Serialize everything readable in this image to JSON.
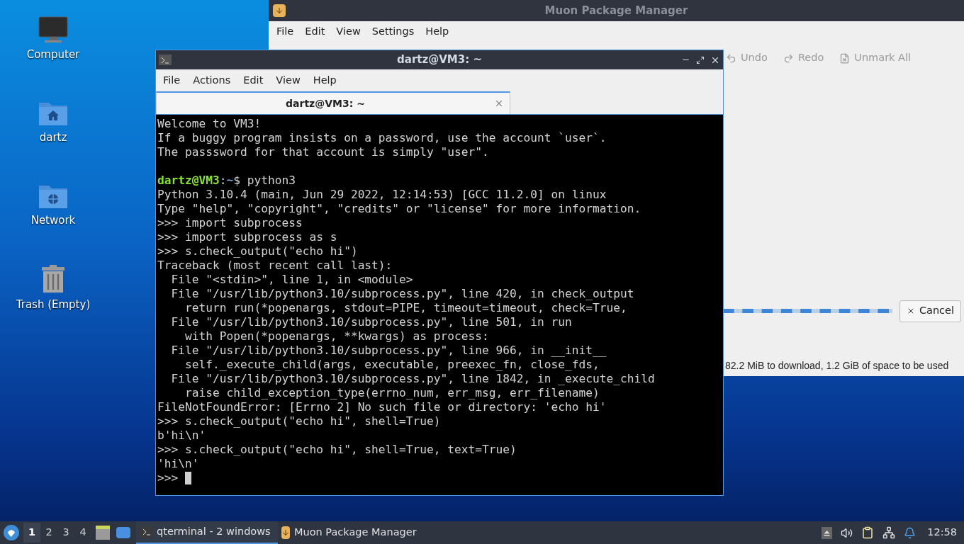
{
  "desktop_icons": [
    {
      "kind": "computer",
      "label": "Computer"
    },
    {
      "kind": "home",
      "label": "dartz"
    },
    {
      "kind": "network",
      "label": "Network"
    },
    {
      "kind": "trash",
      "label": "Trash (Empty)"
    }
  ],
  "muon": {
    "title": "Muon Package Manager",
    "menu": [
      "File",
      "Edit",
      "View",
      "Settings",
      "Help"
    ],
    "toolbar": [
      {
        "kind": "undo",
        "label": "Undo"
      },
      {
        "kind": "redo",
        "label": "Redo"
      },
      {
        "kind": "unmark",
        "label": "Unmark All"
      }
    ],
    "busy": true,
    "cancel_button": "Cancel",
    "status": "82.2 MiB to download, 1.2 GiB of space to be used"
  },
  "terminal": {
    "title": "dartz@VM3: ~",
    "menu": [
      "File",
      "Actions",
      "Edit",
      "View",
      "Help"
    ],
    "tabs": [
      {
        "label": "dartz@VM3: ~",
        "selected": true
      }
    ],
    "lines": [
      {
        "kind": "text",
        "text": "Welcome to VM3!"
      },
      {
        "kind": "text",
        "text": "If a buggy program insists on a password, use the account `user`."
      },
      {
        "kind": "text",
        "text": "The passsword for that account is simply \"user\"."
      },
      {
        "kind": "blank"
      },
      {
        "kind": "prompt",
        "user": "dartz@VM3",
        "colon": ":",
        "path": "~",
        "rest": "$ python3"
      },
      {
        "kind": "text",
        "text": "Python 3.10.4 (main, Jun 29 2022, 12:14:53) [GCC 11.2.0] on linux"
      },
      {
        "kind": "text",
        "text": "Type \"help\", \"copyright\", \"credits\" or \"license\" for more information."
      },
      {
        "kind": "text",
        "text": ">>> import subprocess"
      },
      {
        "kind": "text",
        "text": ">>> import subprocess as s"
      },
      {
        "kind": "text",
        "text": ">>> s.check_output(\"echo hi\")"
      },
      {
        "kind": "text",
        "text": "Traceback (most recent call last):"
      },
      {
        "kind": "text",
        "text": "  File \"<stdin>\", line 1, in <module>"
      },
      {
        "kind": "text",
        "text": "  File \"/usr/lib/python3.10/subprocess.py\", line 420, in check_output"
      },
      {
        "kind": "text",
        "text": "    return run(*popenargs, stdout=PIPE, timeout=timeout, check=True,"
      },
      {
        "kind": "text",
        "text": "  File \"/usr/lib/python3.10/subprocess.py\", line 501, in run"
      },
      {
        "kind": "text",
        "text": "    with Popen(*popenargs, **kwargs) as process:"
      },
      {
        "kind": "text",
        "text": "  File \"/usr/lib/python3.10/subprocess.py\", line 966, in __init__"
      },
      {
        "kind": "text",
        "text": "    self._execute_child(args, executable, preexec_fn, close_fds,"
      },
      {
        "kind": "text",
        "text": "  File \"/usr/lib/python3.10/subprocess.py\", line 1842, in _execute_child"
      },
      {
        "kind": "text",
        "text": "    raise child_exception_type(errno_num, err_msg, err_filename)"
      },
      {
        "kind": "text",
        "text": "FileNotFoundError: [Errno 2] No such file or directory: 'echo hi'"
      },
      {
        "kind": "text",
        "text": ">>> s.check_output(\"echo hi\", shell=True)"
      },
      {
        "kind": "text",
        "text": "b'hi\\n'"
      },
      {
        "kind": "text",
        "text": ">>> s.check_output(\"echo hi\", shell=True, text=True)"
      },
      {
        "kind": "text",
        "text": "'hi\\n'"
      },
      {
        "kind": "cursor",
        "text": ">>>"
      }
    ]
  },
  "taskbar": {
    "workspaces": [
      {
        "label": "1",
        "selected": true
      },
      {
        "label": "2",
        "selected": false
      },
      {
        "label": "3",
        "selected": false
      },
      {
        "label": "4",
        "selected": false
      }
    ],
    "tasks": [
      {
        "kind": "terminal",
        "label": "qterminal - 2 windows",
        "selected": true
      },
      {
        "kind": "package",
        "label": "Muon Package Manager",
        "selected": false
      }
    ],
    "clock": "12:58"
  }
}
